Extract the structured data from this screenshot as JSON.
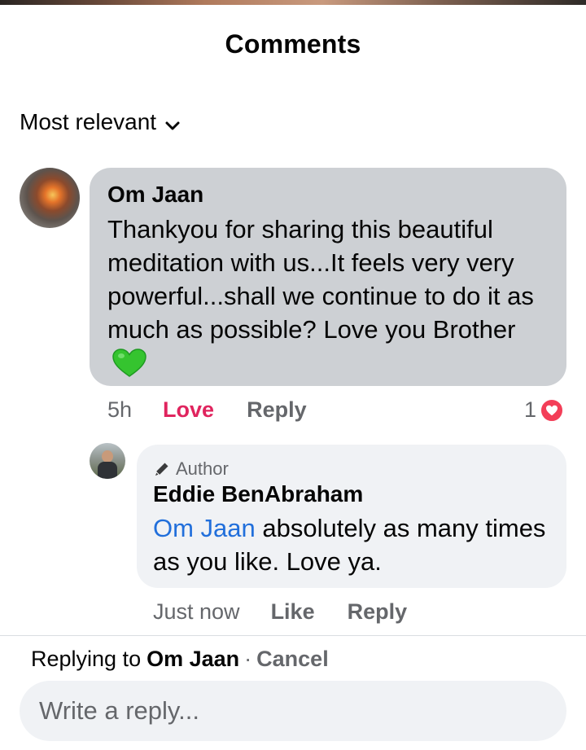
{
  "header": {
    "title": "Comments"
  },
  "sort": {
    "label": "Most relevant"
  },
  "comments": [
    {
      "author": "Om Jaan",
      "text": "Thankyou for sharing this beautiful meditation with us...It feels very very powerful...shall we continue to do it as much as possible? Love you Brother",
      "emoji": "green-heart",
      "time": "5h",
      "reaction_label": "Love",
      "reply_label": "Reply",
      "reaction_count": "1",
      "reaction_type": "heart"
    }
  ],
  "reply": {
    "author_badge": "Author",
    "author": "Eddie BenAbraham",
    "mention": "Om Jaan",
    "text": " absolutely as many times as you like. Love ya.",
    "time": "Just now",
    "like_label": "Like",
    "reply_label": "Reply"
  },
  "composer": {
    "replying_prefix": "Replying to",
    "replying_target": "Om Jaan",
    "separator": "·",
    "cancel_label": "Cancel",
    "placeholder": "Write a reply..."
  },
  "colors": {
    "love_red": "#e0245e",
    "mention_blue": "#216fdb",
    "bubble_gray": "#cdd0d4",
    "bubble_light": "#f0f2f5",
    "heart_badge": "#f33e58",
    "green_heart": "#35c42f"
  }
}
